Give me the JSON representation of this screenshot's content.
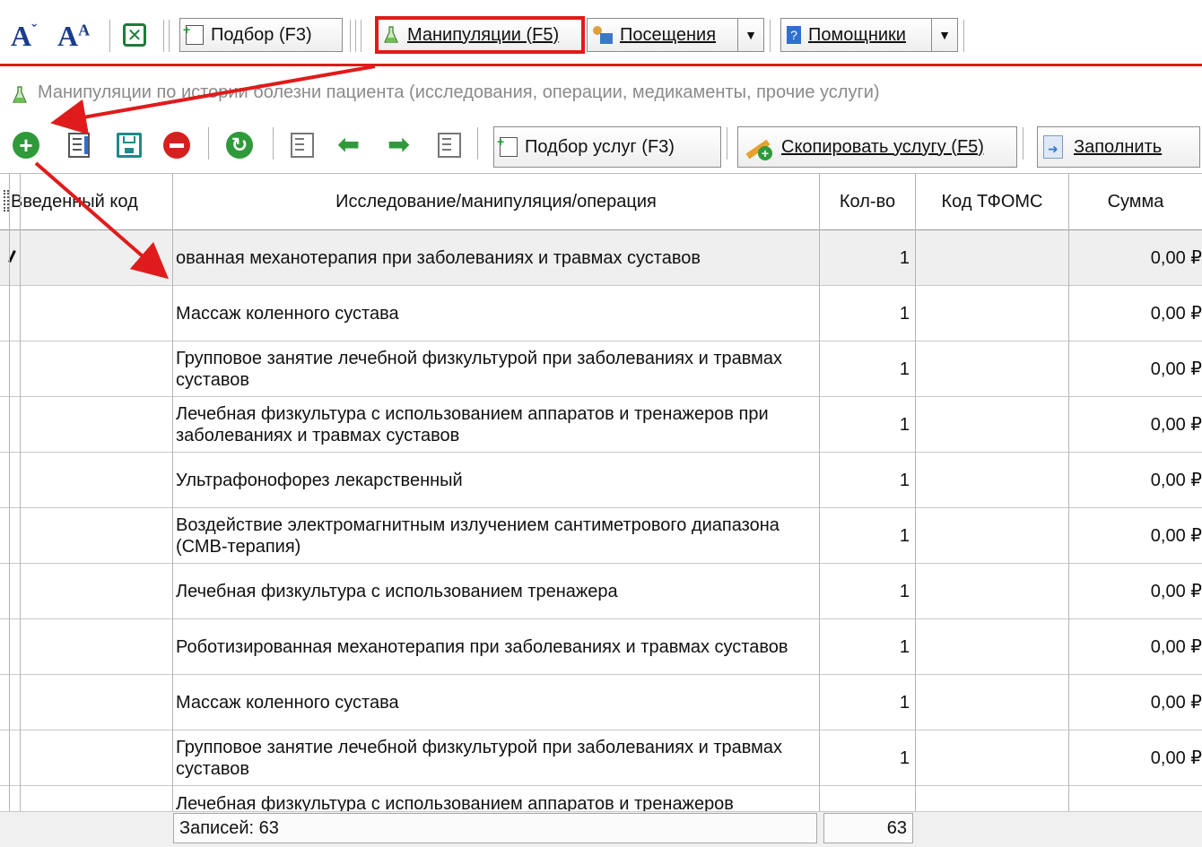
{
  "toolbar": {
    "font_decrease": "A",
    "font_increase": "A",
    "font_sup": "A",
    "podbor_label": "Подбор (F3)",
    "manipulations_label": "Манипуляции (F5)",
    "visits_label": "Посещения",
    "helpers_label": "Помощники"
  },
  "subtitle": "Манипуляции по истории болезни пациента (исследования, операции, медикаменты, прочие услуги)",
  "toolbar2": {
    "podbor_uslug_label": "Подбор услуг (F3)",
    "copy_label": "Скопировать услугу (F5)",
    "fill_label": "Заполнить"
  },
  "columns": {
    "code": "Введенный код",
    "name": "Исследование/манипуляция/операция",
    "qty": "Кол-во",
    "tfoms": "Код ТФОМС",
    "sum": "Сумма"
  },
  "rows": [
    {
      "name": "ованная механотерапия при заболеваниях и травмах суставов",
      "qty": "1",
      "sum": "0,00 ₽"
    },
    {
      "name": "Массаж коленного сустава",
      "qty": "1",
      "sum": "0,00 ₽"
    },
    {
      "name": "Групповое занятие лечебной физкультурой при заболеваниях и травмах суставов",
      "qty": "1",
      "sum": "0,00 ₽"
    },
    {
      "name": "Лечебная физкультура с использованием аппаратов и тренажеров при заболеваниях и травмах суставов",
      "qty": "1",
      "sum": "0,00 ₽"
    },
    {
      "name": "Ультрафонофорез лекарственный",
      "qty": "1",
      "sum": "0,00 ₽"
    },
    {
      "name": "Воздействие электромагнитным излучением сантиметрового диапазона (СМВ-терапия)",
      "qty": "1",
      "sum": "0,00 ₽"
    },
    {
      "name": "Лечебная физкультура с использованием тренажера",
      "qty": "1",
      "sum": "0,00 ₽"
    },
    {
      "name": "Роботизированная механотерапия при заболеваниях и травмах суставов",
      "qty": "1",
      "sum": "0,00 ₽"
    },
    {
      "name": "Массаж коленного сустава",
      "qty": "1",
      "sum": "0,00 ₽"
    },
    {
      "name": "Групповое занятие лечебной физкультурой при заболеваниях и травмах суставов",
      "qty": "1",
      "sum": "0,00 ₽"
    },
    {
      "name": "Лечебная физкультура с использованием аппаратов и тренажеров",
      "qty": "",
      "sum": ""
    }
  ],
  "footer": {
    "records": "Записей: 63",
    "total_qty": "63"
  },
  "colors": {
    "highlight": "#e01b1b",
    "selected_row": "#efefef"
  }
}
